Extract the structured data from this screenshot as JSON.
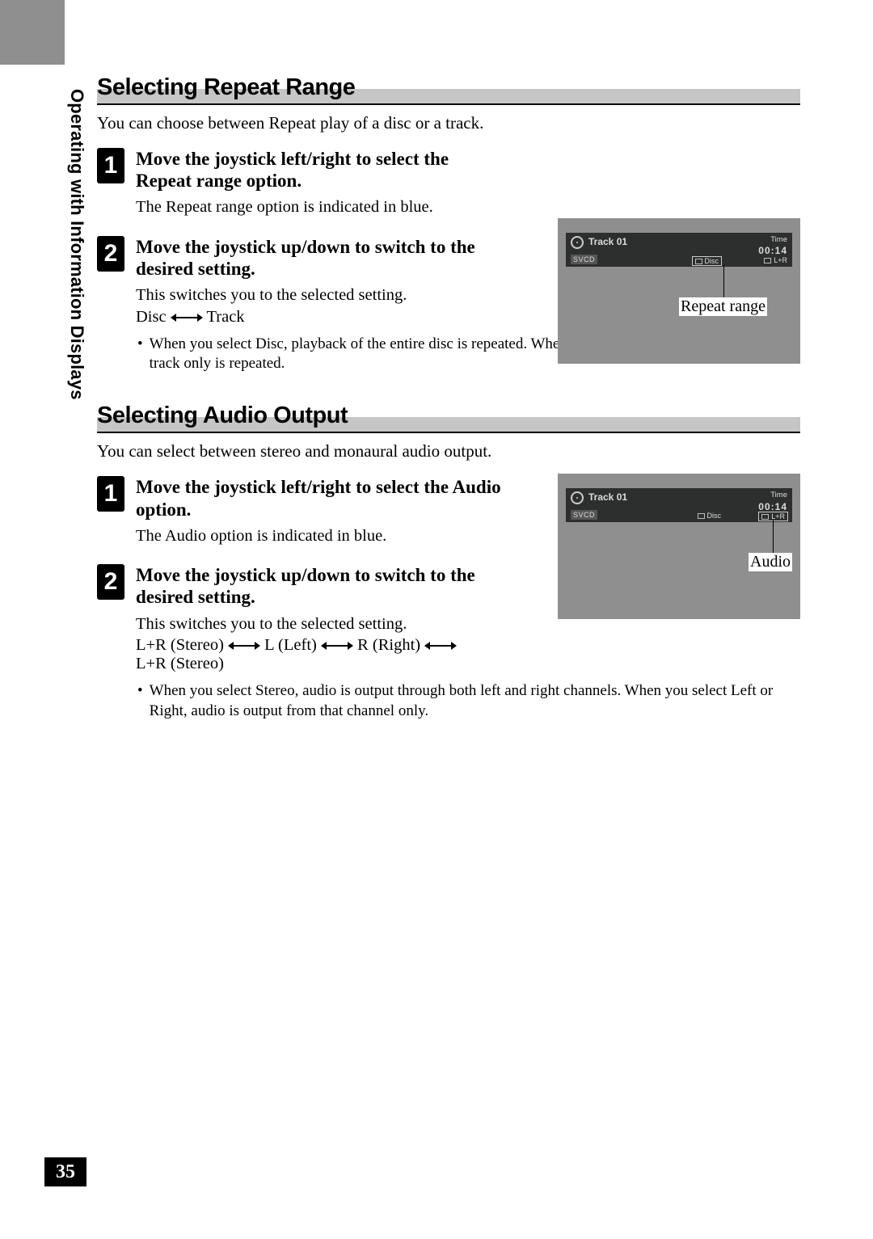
{
  "sideLabel": "Operating with Information Displays",
  "pageNumber": "35",
  "section1": {
    "heading": "Selecting Repeat Range",
    "intro": "You can choose between Repeat play of a disc or a track.",
    "step1": {
      "num": "1",
      "title": "Move the joystick left/right to select the Repeat range option.",
      "desc": "The Repeat range option is indicated in blue."
    },
    "step2": {
      "num": "2",
      "title": "Move the joystick up/down to switch to the desired setting.",
      "desc": "This switches you to the selected setting.",
      "cycleLeft": "Disc",
      "cycleRight": "Track"
    },
    "note": "When you select Disc, playback of the entire disc is repeated. When you select Track, playback of that track only is repeated.",
    "illus": {
      "track": "Track 01",
      "disc": "SVCD",
      "timeLabel": "Time",
      "timeValue": "00:14",
      "repeatLabel": "Disc",
      "audioLabel": "L+R",
      "callout": "Repeat range"
    }
  },
  "section2": {
    "heading": "Selecting Audio Output",
    "intro": "You can select between stereo and monaural audio output.",
    "step1": {
      "num": "1",
      "title": "Move the joystick left/right to select the Audio option.",
      "desc": "The Audio option is indicated in blue."
    },
    "step2": {
      "num": "2",
      "title": "Move the joystick up/down to switch to the desired setting.",
      "desc": "This switches you to the selected setting.",
      "cycle1": "L+R (Stereo)",
      "cycle2": "L (Left)",
      "cycle3": "R (Right)",
      "cycle4": "L+R (Stereo)"
    },
    "note": "When you select Stereo, audio is output through both left and right channels. When you select Left or Right, audio is output from that channel only.",
    "illus": {
      "track": "Track 01",
      "disc": "SVCD",
      "timeLabel": "Time",
      "timeValue": "00:14",
      "repeatLabel": "Disc",
      "audioLabel": "L+R",
      "callout": "Audio"
    }
  }
}
